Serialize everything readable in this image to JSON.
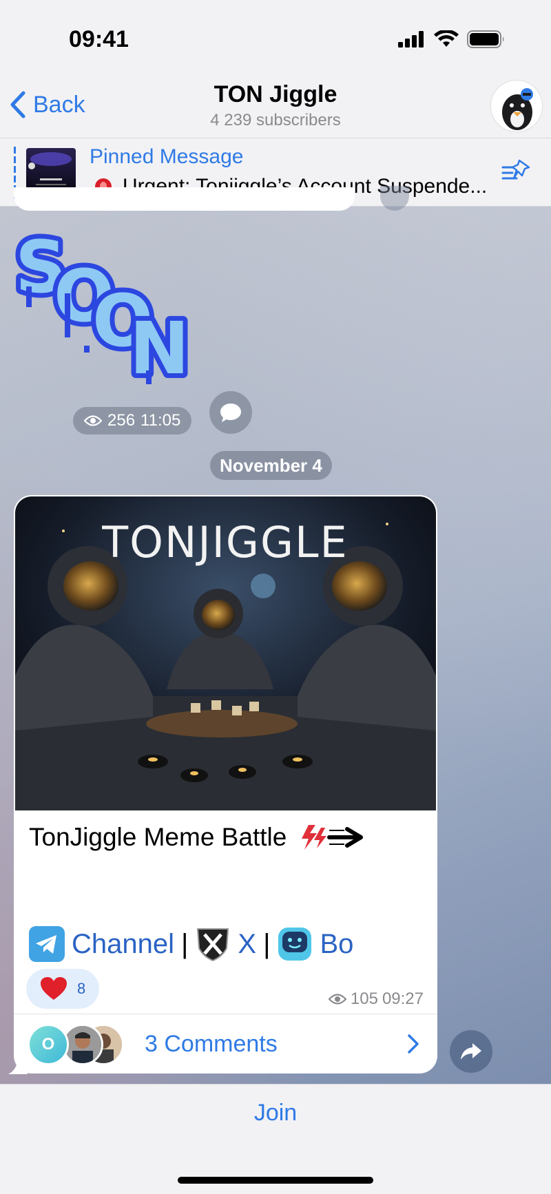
{
  "status_bar": {
    "time": "09:41",
    "icons": [
      "signal-icon",
      "wifi-icon",
      "battery-icon"
    ]
  },
  "header": {
    "back_label": "Back",
    "title": "TON Jiggle",
    "subtitle": "4 239 subscribers"
  },
  "pinned": {
    "heading": "Pinned Message",
    "text": "Urgent: Tonjiggle’s Account Suspende..."
  },
  "sticker_message": {
    "sticker_text": "SOON",
    "views": "256",
    "time": "11:05"
  },
  "date_separator": "November 4",
  "post": {
    "image_title": "TONJIGGLE",
    "title": "TonJiggle Meme Battle",
    "links": [
      {
        "label": "Channel",
        "icon": "telegram-icon"
      },
      {
        "label": "X",
        "icon": "x-icon"
      },
      {
        "label": "Bo",
        "icon": "bot-icon"
      }
    ],
    "separator": "|",
    "reaction": {
      "emoji": "heart-icon",
      "count": "8"
    },
    "views": "105",
    "time": "09:27",
    "comments_label": "3 Comments",
    "commenter_initial": "O"
  },
  "bottom": {
    "join_label": "Join"
  },
  "colors": {
    "accent": "#2f7ae5",
    "link": "#2a63c4",
    "background": "#b5bccb"
  }
}
